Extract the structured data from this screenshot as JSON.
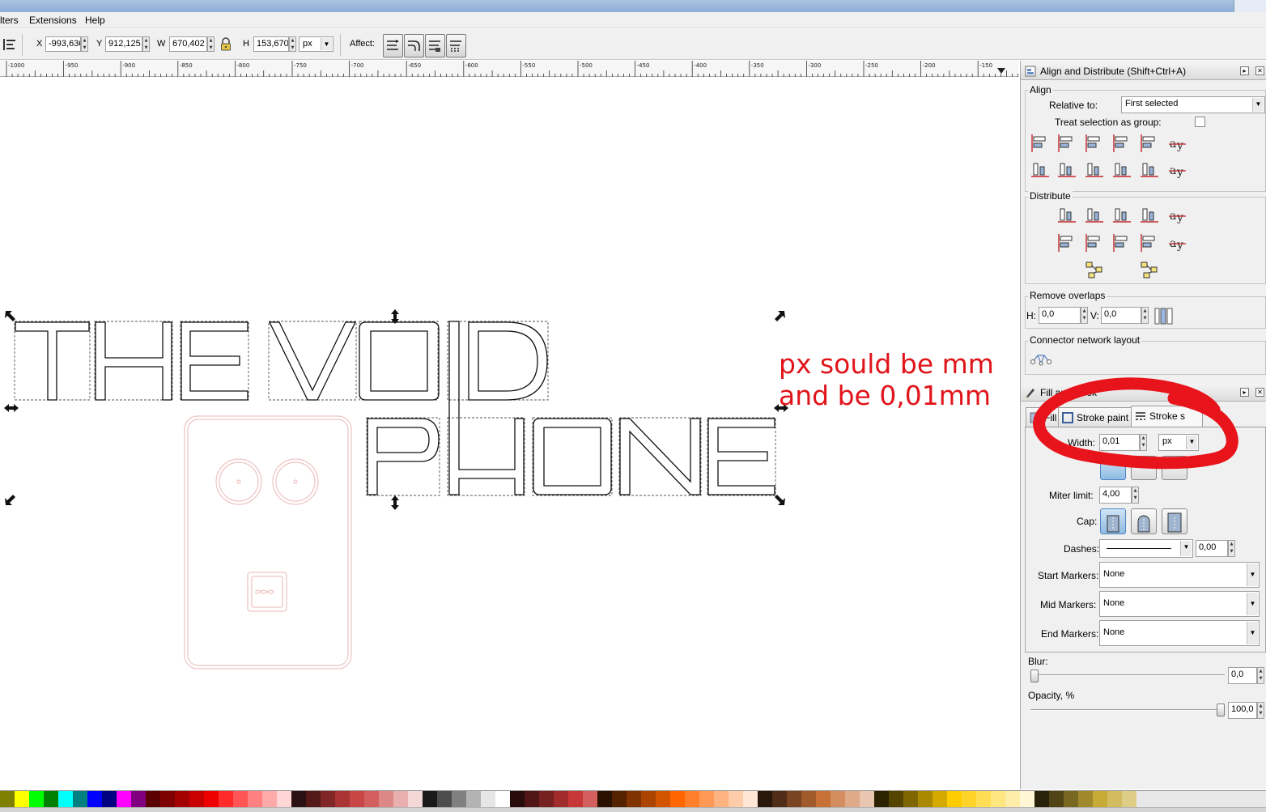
{
  "menu": {
    "items": [
      "lters",
      "Extensions",
      "Help"
    ]
  },
  "toolbar": {
    "x_label": "X",
    "x_value": "-993,636",
    "y_label": "Y",
    "y_value": "912,125",
    "w_label": "W",
    "w_value": "670,402",
    "h_label": "H",
    "h_value": "153,670",
    "unit": "px",
    "affect_label": "Affect:"
  },
  "ruler": {
    "labels": [
      "-1000",
      "-950",
      "-900",
      "-850",
      "-800",
      "-750",
      "-700",
      "-650",
      "-600",
      "-550",
      "-500",
      "-450",
      "-400",
      "-350",
      "-300",
      "-250",
      "-200",
      "-150"
    ]
  },
  "canvas": {
    "text_line1": "THE VOID",
    "text_line2": "PHONE",
    "annotation_line1": "px sould be mm",
    "annotation_line2": "and be 0,01mm",
    "annotation_color": "#e0151b"
  },
  "align_panel": {
    "title": "Align and Distribute (Shift+Ctrl+A)",
    "align_section": "Align",
    "relative_to_label": "Relative to:",
    "relative_to_value": "First selected",
    "treat_group_label": "Treat selection as group:",
    "distribute_section": "Distribute",
    "remove_overlaps_section": "Remove overlaps",
    "h_label": "H:",
    "h_value": "0,0",
    "v_label": "V:",
    "v_value": "0,0",
    "connector_section": "Connector network layout"
  },
  "fill_stroke_panel": {
    "title": "Fill and Strok",
    "tab_fill": "Fill",
    "tab_stroke_paint": "Stroke paint",
    "tab_stroke_style": "Stroke s",
    "width_label": "Width:",
    "width_value": "0,01",
    "width_unit": "px",
    "miter_label": "Miter limit:",
    "miter_value": "4,00",
    "cap_label": "Cap:",
    "dashes_label": "Dashes:",
    "dashes_value": "0,00",
    "start_markers_label": "Start Markers:",
    "start_markers_value": "None",
    "mid_markers_label": "Mid Markers:",
    "mid_markers_value": "None",
    "end_markers_label": "End Markers:",
    "end_markers_value": "None",
    "blur_label": "Blur:",
    "blur_value": "0,0",
    "opacity_label": "Opacity, %",
    "opacity_value": "100,0",
    "highlight_color": "#e8141b"
  },
  "palette": {
    "colors": [
      "#808000",
      "#ffff00",
      "#00ff00",
      "#008000",
      "#00ffff",
      "#008080",
      "#0000ff",
      "#000080",
      "#ff00ff",
      "#800080",
      "#5a0000",
      "#7f0000",
      "#a30000",
      "#c80000",
      "#ee0000",
      "#ff2a2a",
      "#ff5555",
      "#ff8080",
      "#ffaaaa",
      "#ffd5d5",
      "#2b1111",
      "#551919",
      "#802626",
      "#aa3333",
      "#c84646",
      "#d35f5f",
      "#de8787",
      "#e9afaf",
      "#f4d7d7",
      "#1a1a1a",
      "#4d4d4d",
      "#808080",
      "#b3b3b3",
      "#e6e6e6",
      "#ffffff",
      "#280b0b",
      "#501616",
      "#782121",
      "#a02c2c",
      "#c83737",
      "#d35f5f",
      "#2b1100",
      "#552200",
      "#803300",
      "#aa4400",
      "#d45500",
      "#ff6600",
      "#ff7f2a",
      "#ff9955",
      "#ffb380",
      "#ffccaa",
      "#ffe6d5",
      "#28170b",
      "#502d16",
      "#784421",
      "#a05a2c",
      "#c87137",
      "#d38d5f",
      "#deaa87",
      "#e9c6af",
      "#2b2200",
      "#554400",
      "#806600",
      "#aa8800",
      "#d4aa00",
      "#ffcc00",
      "#ffd42a",
      "#ffdd55",
      "#ffe680",
      "#ffeeaa",
      "#fff6d5",
      "#28220b",
      "#504416",
      "#786721",
      "#a0892c",
      "#c8ab37",
      "#d3bc5f",
      "#decd87"
    ]
  }
}
